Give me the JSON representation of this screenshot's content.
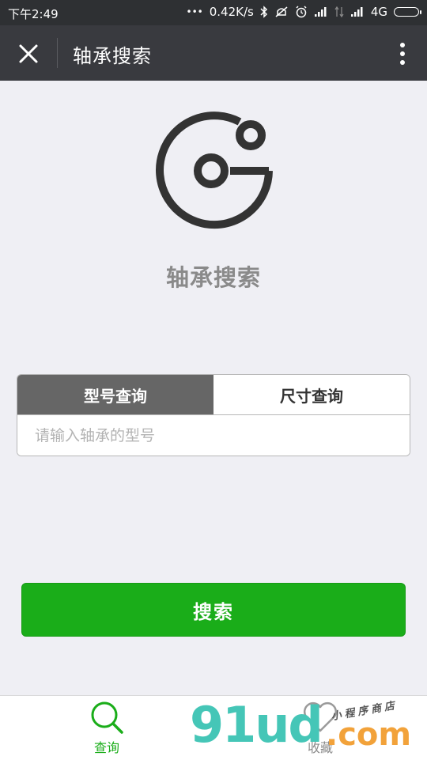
{
  "status_bar": {
    "time": "下午2:49",
    "dots": "•••",
    "speed": "0.42K/s",
    "network": "4G"
  },
  "nav": {
    "title": "轴承搜索"
  },
  "app_name": "轴承搜索",
  "search": {
    "tabs": [
      {
        "label": "型号查询",
        "active": true
      },
      {
        "label": "尺寸查询",
        "active": false
      }
    ],
    "placeholder": "请输入轴承的型号",
    "button_label": "搜索"
  },
  "tab_bar": {
    "items": [
      {
        "label": "查询",
        "icon": "search-icon",
        "active": true
      },
      {
        "label": "收藏",
        "icon": "heart-icon",
        "active": false
      }
    ]
  },
  "watermark": {
    "main": "91ud",
    "com": ".com",
    "cn": "小程序商店"
  },
  "colors": {
    "accent": "#1aad19",
    "nav_bg": "#393a3f",
    "page_bg": "#efeff4"
  }
}
